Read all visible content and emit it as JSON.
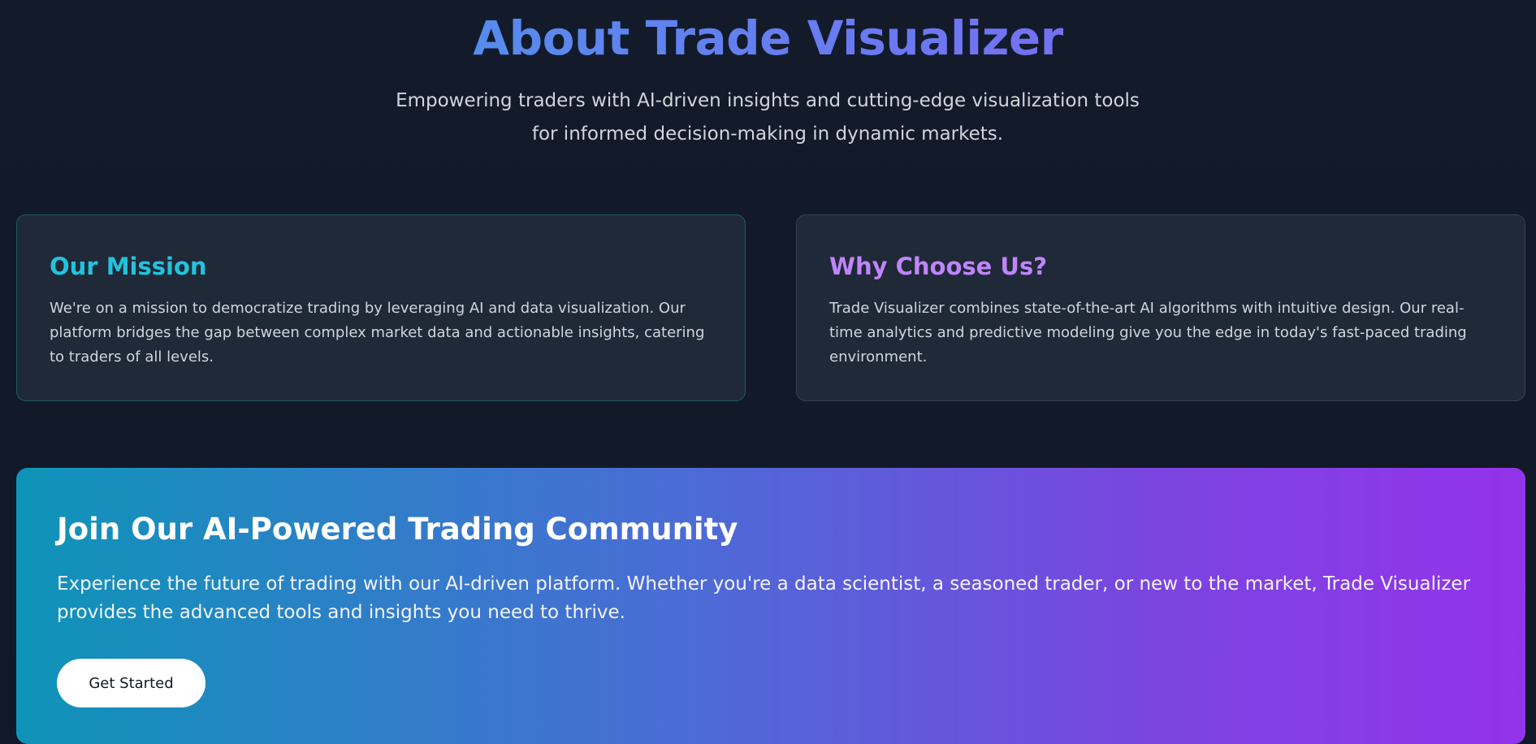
{
  "hero": {
    "title": "About Trade Visualizer",
    "subtitle": "Empowering traders with AI-driven insights and cutting-edge visualization tools for informed decision-making in dynamic markets."
  },
  "cards": {
    "mission": {
      "title": "Our Mission",
      "text": "We're on a mission to democratize trading by leveraging AI and data visualization. Our platform bridges the gap between complex market data and actionable insights, catering to traders of all levels.",
      "accent": "#22c3dd"
    },
    "why": {
      "title": "Why Choose Us?",
      "text": "Trade Visualizer combines state-of-the-art AI algorithms with intuitive design. Our real-time analytics and predictive modeling give you the edge in today's fast-paced trading environment.",
      "accent": "#c084fc"
    }
  },
  "cta": {
    "title": "Join Our AI-Powered Trading Community",
    "text": "Experience the future of trading with our AI-driven platform. Whether you're a data scientist, a seasoned trader, or new to the market, Trade Visualizer provides the advanced tools and insights you need to thrive.",
    "button_label": "Get Started",
    "gradient_start": "#0e94b8",
    "gradient_end": "#9333ea"
  },
  "colors": {
    "background": "#111827",
    "card_background": "#1f2937",
    "title_gradient_start": "#3fa0ea",
    "title_gradient_end": "#8b5cf6"
  }
}
